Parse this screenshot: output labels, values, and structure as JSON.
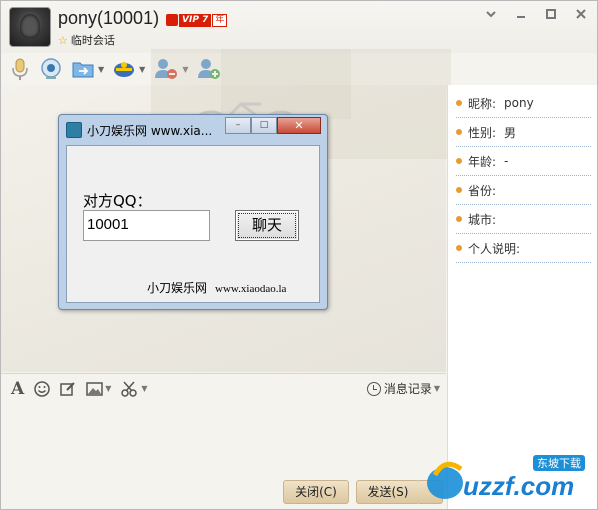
{
  "header": {
    "contact_name": "pony(10001)",
    "vip_label": "VIP 7",
    "vip_year": "年",
    "session_type": "临时会话",
    "window_controls": [
      "chevron-down-icon",
      "minimize-icon",
      "maximize-icon",
      "close-icon"
    ]
  },
  "toolbar": {
    "items": [
      {
        "icon": "microphone-icon"
      },
      {
        "icon": "camera-icon"
      },
      {
        "icon": "file-transfer-icon",
        "has_menu": true
      },
      {
        "icon": "remote-assist-icon",
        "has_menu": true
      },
      {
        "icon": "remove-contact-icon"
      },
      {
        "icon": "add-contact-icon"
      }
    ]
  },
  "dialog": {
    "title": "小刀娱乐网  www.xia...",
    "qq_label": "对方QQ：",
    "qq_value": "10001",
    "chat_button": "聊天",
    "footer_name": "小刀娱乐网",
    "footer_url": "www.xiaodao.la",
    "min_glyph": "–",
    "max_glyph": "□",
    "close_glyph": "✕"
  },
  "input_toolbar": {
    "history_label": "消息记录"
  },
  "buttons": {
    "close_label": "关闭(C)",
    "send_label": "发送(S)"
  },
  "profile": {
    "rows": [
      {
        "label": "昵称:",
        "value": "pony"
      },
      {
        "label": "性别:",
        "value": "男"
      },
      {
        "label": "年龄:",
        "value": "-"
      },
      {
        "label": "省份:",
        "value": ""
      },
      {
        "label": "城市:",
        "value": ""
      },
      {
        "label": "个人说明:",
        "value": ""
      }
    ]
  },
  "watermark": {
    "brand": "uzzf.com",
    "tag": "东坡下载"
  },
  "colors": {
    "accent": "#e99c2d",
    "vip": "#d81e06",
    "button": "#ddc79e"
  }
}
